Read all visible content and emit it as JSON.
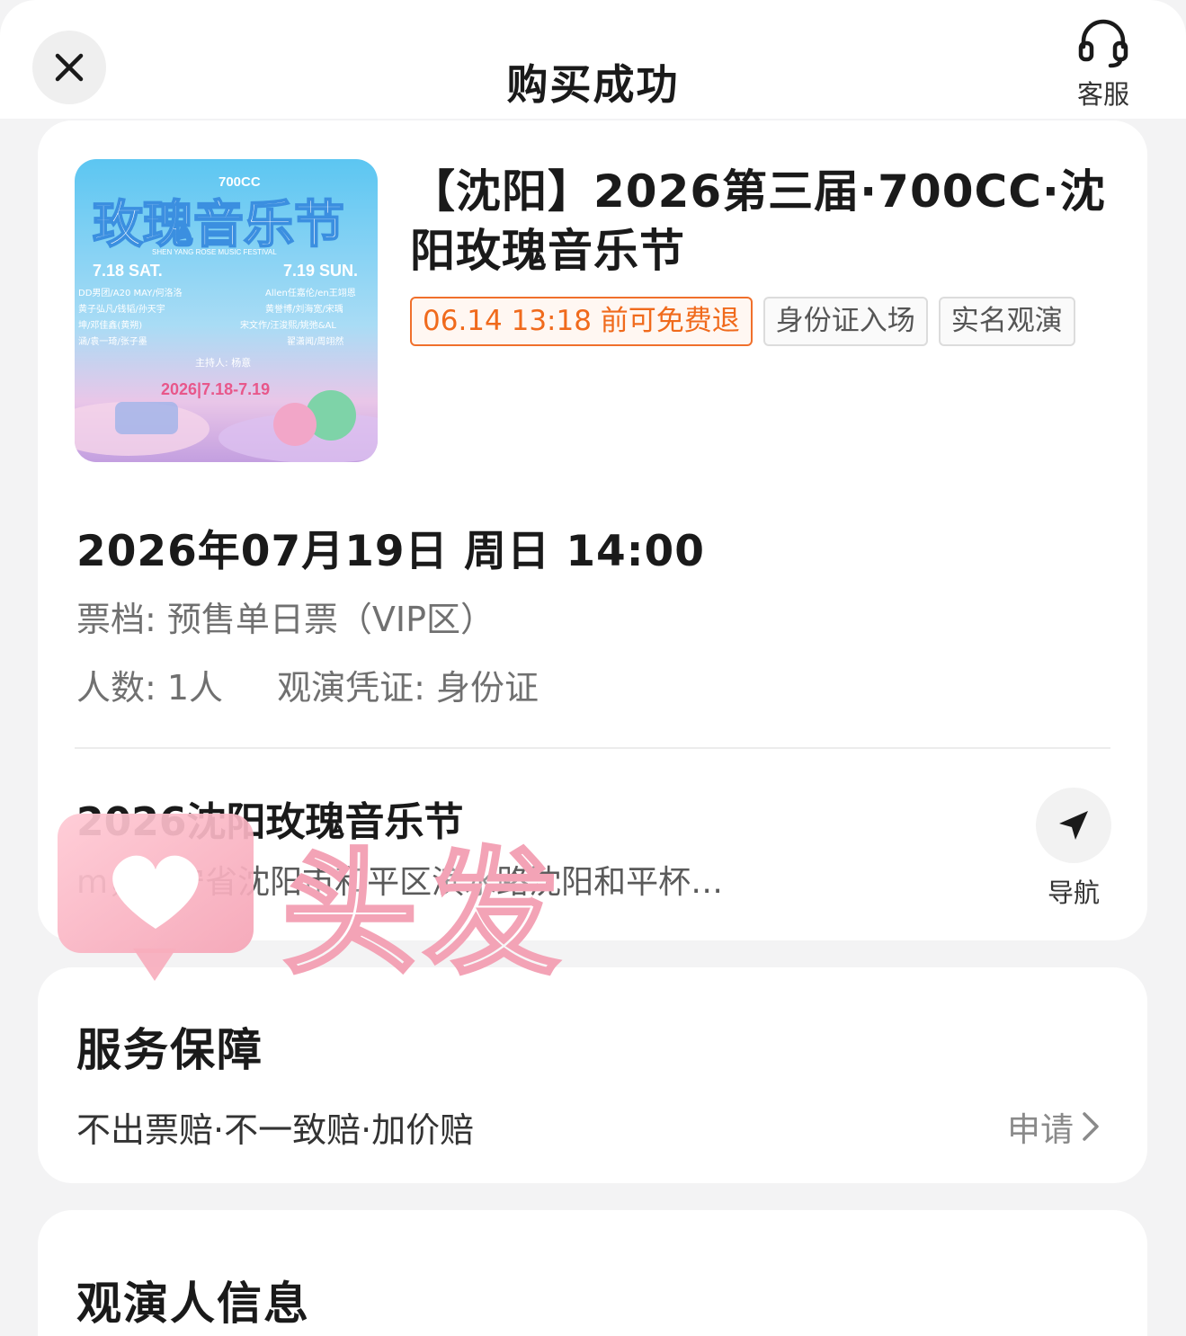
{
  "header": {
    "title": "购买成功",
    "close_icon": "close-icon",
    "service_label": "客服",
    "service_icon": "headset-icon"
  },
  "event": {
    "poster": {
      "title": "玫瑰音乐节",
      "brand_top": "玫瑰\n音乐节",
      "brand_700cc": "700CC",
      "subtitle": "SHEN YANG ROSE MUSIC FESTIVAL",
      "day1": "7.18 SAT.",
      "day2": "7.19 SUN.",
      "lineup_left": [
        "DD男团/A20 MAY/何洛洛",
        "黄子弘凡/钱韬/孙天宇",
        "坤/邓佳鑫(黄朔)",
        "涵/袁一琦/张子墨"
      ],
      "lineup_right": [
        "Allen任嘉伦/en王翊恩",
        "黄誉博/刘海宽/宋瑀",
        "宋文作/汪浚熙/姚弛&AL",
        "翟潇闻/周翊然"
      ],
      "host": "主持人: 杨意",
      "dates": "2026|7.18-7.19"
    },
    "title": "【沈阳】2026第三届·700CC·沈阳玫瑰音乐节",
    "tags": [
      {
        "label": "06.14 13:18 前可免费退",
        "accent": "#f06a1c"
      },
      {
        "label": "身份证入场"
      },
      {
        "label": "实名观演"
      }
    ],
    "datetime": "2026年07月19日 周日 14:00",
    "tier": "票档: 预售单日票（VIP区）",
    "count": "人数: 1人",
    "credential": "观演凭证: 身份证",
    "venue_name": "2026沈阳玫瑰音乐节",
    "venue_address": "m，辽宁省沈阳市和平区滨水路沈阳和平杯…",
    "nav_label": "导航",
    "nav_icon": "navigation-arrow-icon"
  },
  "service": {
    "title": "服务保障",
    "items": "不出票赔·不一致赔·加价赔",
    "apply_label": "申请",
    "chevron_icon": "chevron-right-icon"
  },
  "viewer": {
    "title": "观演人信息"
  },
  "watermark": {
    "text": "头发",
    "icon": "heart-chat-icon"
  },
  "colors": {
    "accent_orange": "#f06a1c",
    "background": "#f3f3f4",
    "card": "#ffffff",
    "watermark_pink": "#f3a3b6"
  }
}
